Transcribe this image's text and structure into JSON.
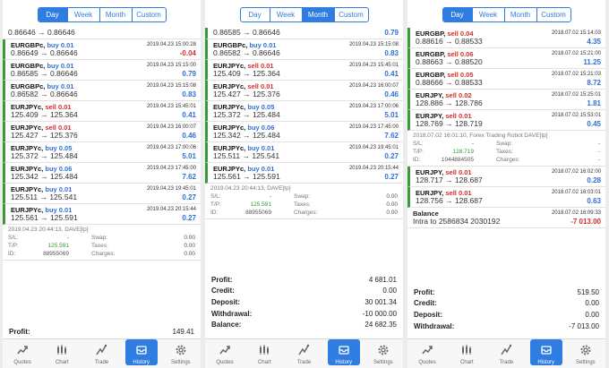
{
  "tabs": [
    "Day",
    "Week",
    "Month",
    "Custom"
  ],
  "bottom_nav": [
    "Quotes",
    "Chart",
    "Trade",
    "History",
    "Settings"
  ],
  "panel1": {
    "active_tab": "Day",
    "top_row": {
      "prices": "0.86646 → 0.86646"
    },
    "rows": [
      {
        "symbol": "EURGBPc,",
        "side": "buy 0.01",
        "date": "2019.04.23 15:00:28",
        "prices": "0.86649 → 0.86646",
        "profit": "-0.04"
      },
      {
        "symbol": "EURGBPc,",
        "side": "buy 0.01",
        "date": "2019.04.23 15:15:00",
        "prices": "0.86585 → 0.86646",
        "profit": "0.79"
      },
      {
        "symbol": "EURGBPc,",
        "side": "buy 0.01",
        "date": "2019.04.23 15:15:08",
        "prices": "0.86582 → 0.86646",
        "profit": "0.83"
      },
      {
        "symbol": "EURJPYc,",
        "side": "sell 0.01",
        "date": "2019.04.23 15:45:01",
        "prices": "125.409 → 125.364",
        "profit": "0.41"
      },
      {
        "symbol": "EURJPYc,",
        "side": "sell 0.01",
        "date": "2019.04.23 16:00:07",
        "prices": "125.427 → 125.376",
        "profit": "0.46"
      },
      {
        "symbol": "EURJPYc,",
        "side": "buy 0.05",
        "date": "2019.04.23 17:00:06",
        "prices": "125.372 → 125.484",
        "profit": "5.01"
      },
      {
        "symbol": "EURJPYc,",
        "side": "buy 0.06",
        "date": "2019.04.23 17:45:00",
        "prices": "125.342 → 125.484",
        "profit": "7.62"
      },
      {
        "symbol": "EURJPYc,",
        "side": "buy 0.01",
        "date": "2019.04.23 19:45:01",
        "prices": "125.511 → 125.541",
        "profit": "0.27"
      },
      {
        "symbol": "EURJPYc,",
        "side": "buy 0.01",
        "date": "2019.04.23 20:15:44",
        "prices": "125.561 → 125.591",
        "profit": "0.27"
      }
    ],
    "detail": {
      "header": "2019.04.23 20:44:13, DAVE[tp]",
      "sl_label": "S/L:",
      "sl": "-",
      "swap_label": "Swap:",
      "swap": "0.00",
      "tp_label": "T/P:",
      "tp": "125.591",
      "taxes_label": "Taxes:",
      "taxes": "0.00",
      "id_label": "ID:",
      "id": "88955069",
      "charges_label": "Charges:",
      "charges": "0.00"
    },
    "summary": [
      {
        "k": "Profit:",
        "v": "149.41"
      }
    ]
  },
  "panel2": {
    "active_tab": "Month",
    "top_row": {
      "prices": "0.86585 → 0.86646",
      "profit": "0.79"
    },
    "rows": [
      {
        "symbol": "EURGBPc,",
        "side": "buy 0.01",
        "date": "2019.04.23 15:15:08",
        "prices": "0.86582 → 0.86646",
        "profit": "0.83"
      },
      {
        "symbol": "EURJPYc,",
        "side": "sell 0.01",
        "date": "2019.04.23 15:45:01",
        "prices": "125.409 → 125.364",
        "profit": "0.41"
      },
      {
        "symbol": "EURJPYc,",
        "side": "sell 0.01",
        "date": "2019.04.23 16:00:07",
        "prices": "125.427 → 125.376",
        "profit": "0.46"
      },
      {
        "symbol": "EURJPYc,",
        "side": "buy 0.05",
        "date": "2019.04.23 17:00:06",
        "prices": "125.372 → 125.484",
        "profit": "5.01"
      },
      {
        "symbol": "EURJPYc,",
        "side": "buy 0.06",
        "date": "2019.04.23 17:45:00",
        "prices": "125.342 → 125.484",
        "profit": "7.62"
      },
      {
        "symbol": "EURJPYc,",
        "side": "buy 0.01",
        "date": "2019.04.23 19:45:01",
        "prices": "125.511 → 125.541",
        "profit": "0.27"
      },
      {
        "symbol": "EURJPYc,",
        "side": "buy 0.01",
        "date": "2019.04.23 20:15:44",
        "prices": "125.561 → 125.591",
        "profit": "0.27"
      }
    ],
    "detail": {
      "header": "2019.04.23 20:44:13, DAVE[tp]",
      "sl_label": "S/L:",
      "sl": "-",
      "swap_label": "Swap:",
      "swap": "0.00",
      "tp_label": "T/P:",
      "tp": "125.591",
      "taxes_label": "Taxes:",
      "taxes": "0.00",
      "id_label": "ID:",
      "id": "88955069",
      "charges_label": "Charges:",
      "charges": "0.00"
    },
    "summary": [
      {
        "k": "Profit:",
        "v": "4 681.01"
      },
      {
        "k": "Credit:",
        "v": "0.00"
      },
      {
        "k": "Deposit:",
        "v": "30 001.34"
      },
      {
        "k": "Withdrawal:",
        "v": "-10 000.00"
      },
      {
        "k": "Balance:",
        "v": "24 682.35"
      }
    ]
  },
  "panel3": {
    "active_tab": "Day",
    "rows": [
      {
        "symbol": "EURGBP,",
        "side": "sell 0.04",
        "date": "2018.07.02 15:14:03",
        "prices": "0.88616 → 0.88533",
        "profit": "4.35"
      },
      {
        "symbol": "EURGBP,",
        "side": "sell 0.06",
        "date": "2018.07.02 15:21:00",
        "prices": "0.88663 → 0.88520",
        "profit": "11.25"
      },
      {
        "symbol": "EURGBP,",
        "side": "sell 0.05",
        "date": "2018.07.02 15:21:03",
        "prices": "0.88666 → 0.88533",
        "profit": "8.72"
      },
      {
        "symbol": "EURJPY,",
        "side": "sell 0.02",
        "date": "2018.07.02 15:25:01",
        "prices": "128.886 → 128.786",
        "profit": "1.81"
      },
      {
        "symbol": "EURJPY,",
        "side": "sell 0.01",
        "date": "2018.07.02 15:53:01",
        "prices": "128.769 → 128.719",
        "profit": "0.45"
      }
    ],
    "detail": {
      "header": "2018.07.02 16:01:10, Forex Trading Robot DAVE[tp]",
      "sl_label": "S/L:",
      "sl": "-",
      "swap_label": "Swap:",
      "swap": "-",
      "tp_label": "T/P:",
      "tp": "128.719",
      "taxes_label": "Taxes:",
      "taxes": "-",
      "id_label": "ID:",
      "id": "1044884505",
      "charges_label": "Charges:",
      "charges": "-"
    },
    "rows2": [
      {
        "symbol": "EURJPY,",
        "side": "sell 0.01",
        "date": "2018.07.02 16:02:00",
        "prices": "128.717 → 128.687",
        "profit": "0.28"
      },
      {
        "symbol": "EURJPY,",
        "side": "sell 0.01",
        "date": "2018.07.02 16:03:01",
        "prices": "128.756 → 128.687",
        "profit": "0.63"
      }
    ],
    "balance_row": {
      "title": "Balance",
      "date": "2018.07.02 16:09:33",
      "text": "Intra to 2586834 2030192",
      "amount": "-7 013.00"
    },
    "summary": [
      {
        "k": "Profit:",
        "v": "519.50"
      },
      {
        "k": "Credit:",
        "v": "0.00"
      },
      {
        "k": "Deposit:",
        "v": "0.00"
      },
      {
        "k": "Withdrawal:",
        "v": "-7 013.00"
      }
    ]
  },
  "colors": {
    "accent": "#2f7de1",
    "buy": "#2f6fd6",
    "sell": "#d52c2c",
    "bar": "#3a9a3a"
  }
}
